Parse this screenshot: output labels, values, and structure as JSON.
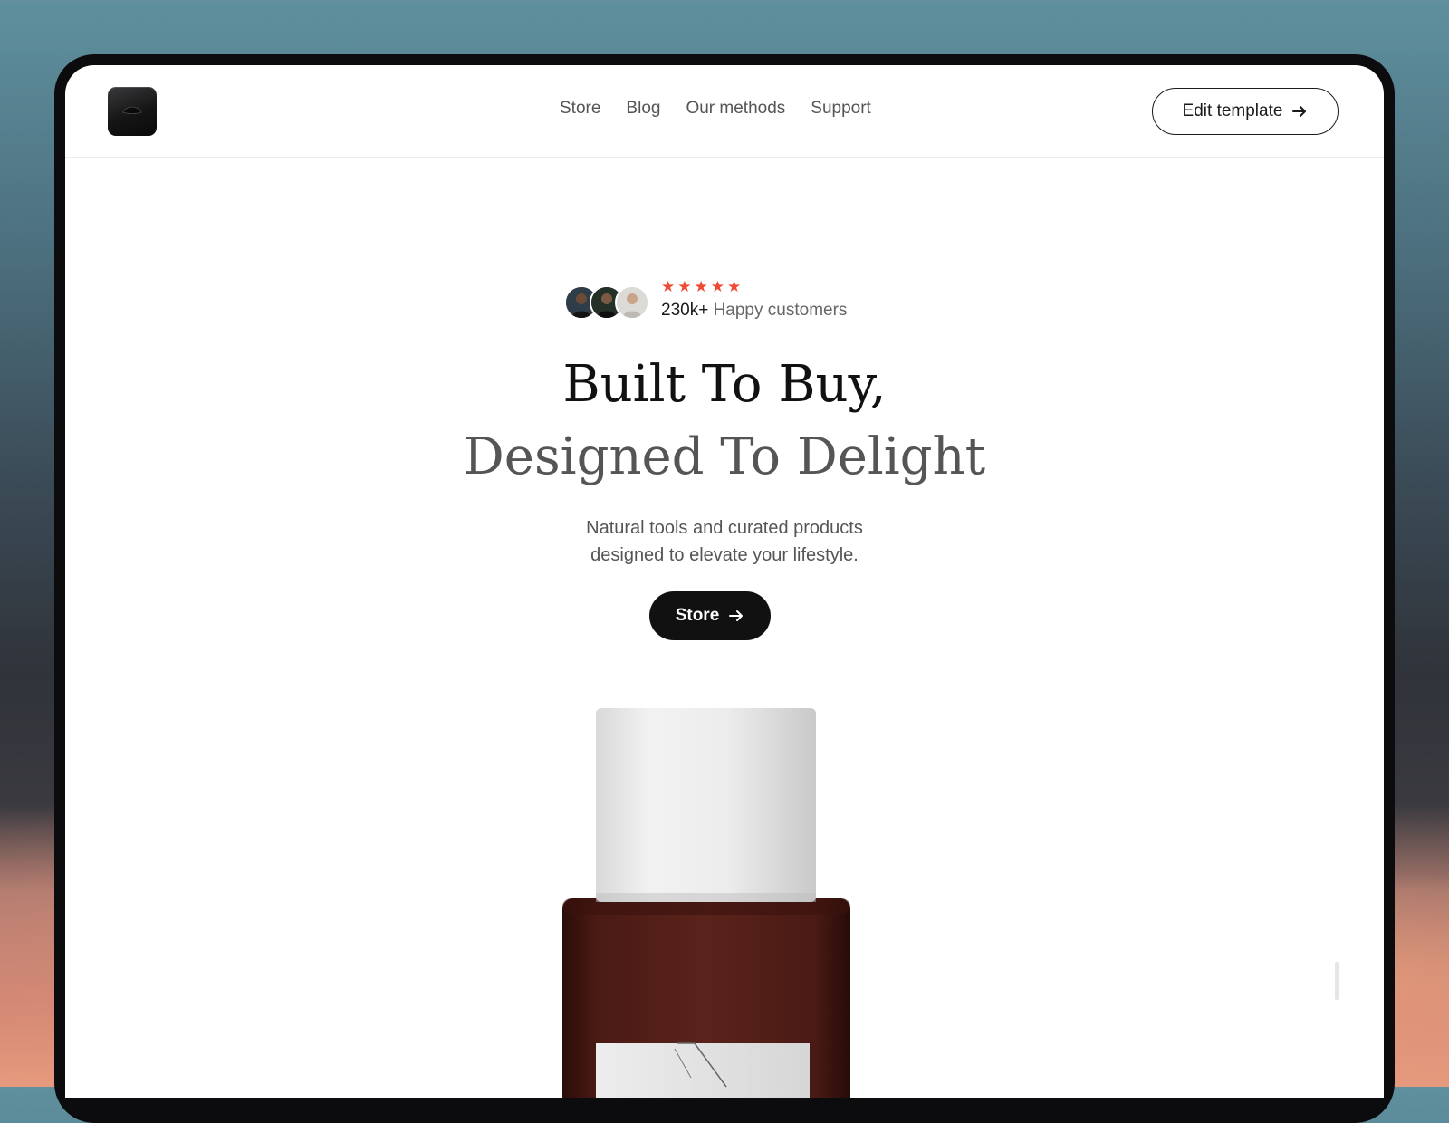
{
  "nav": {
    "links": [
      "Store",
      "Blog",
      "Our methods",
      "Support"
    ],
    "edit_template_label": "Edit template"
  },
  "hero": {
    "rating_stars": 5,
    "stars": [
      "★",
      "★",
      "★",
      "★",
      "★"
    ],
    "customers_count": "230k+",
    "customers_label": "Happy customers",
    "headline_line1": "Built To Buy,",
    "headline_line2": "Designed To Delight",
    "subtext_line1": "Natural tools and curated products",
    "subtext_line2": "designed to elevate your lifestyle.",
    "cta_label": "Store"
  },
  "colors": {
    "accent_star": "#ee4b35",
    "primary_button": "#111111",
    "bottle_glass": "#4a1a14",
    "bottle_cap": "#e9e9e9"
  },
  "icons": {
    "logo": "brand-logo-icon",
    "edit_arrow": "arrow-right-icon",
    "cta_arrow": "arrow-right-icon",
    "star": "star-icon"
  }
}
